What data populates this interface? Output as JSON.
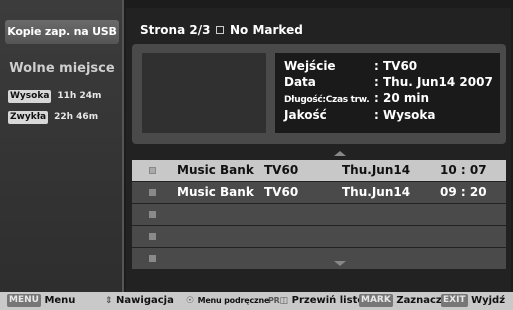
{
  "sidebar": {
    "title": "Kopie zap. na USB",
    "free_label": "Wolne miejsce",
    "qualities": [
      {
        "label": "Wysoka",
        "time": "11h 24m"
      },
      {
        "label": "Zwykła",
        "time": "22h 46m"
      }
    ]
  },
  "header": {
    "page": "Strona 2/3",
    "marked_icon": "checkbox-icon",
    "marked_text": "No Marked"
  },
  "details": {
    "channel_key": "Wejście",
    "channel_val": ": TV60",
    "date_key": "Data",
    "date_val": ": Thu. Jun14 2007",
    "duration_key": "Długość:Czas trw.",
    "duration_val": ": 20 min",
    "quality_key": "Jakość",
    "quality_val": ": Wysoka"
  },
  "recordings": [
    {
      "title": "Music Bank",
      "channel": "TV60",
      "date": "Thu.Jun14",
      "time": "10 : 07",
      "selected": true
    },
    {
      "title": "Music Bank",
      "channel": "TV60",
      "date": "Thu.Jun14",
      "time": "09 : 20",
      "selected": false
    },
    {
      "title": "",
      "channel": "",
      "date": "",
      "time": "",
      "selected": false
    },
    {
      "title": "",
      "channel": "",
      "date": "",
      "time": "",
      "selected": false
    },
    {
      "title": "",
      "channel": "",
      "date": "",
      "time": "",
      "selected": false
    }
  ],
  "footer": {
    "menu_key": "MENU",
    "menu_label": "Menu",
    "nav_icon": "up-down-arrows-icon",
    "nav_label": "Nawigacja",
    "ok_icon": "ok-circle-icon",
    "submenu_label": "Menu podręczne",
    "pr_key": "PR",
    "scroll_label": "Przewiń listę",
    "mark_key": "MARK",
    "mark_label": "Zaznacz",
    "exit_key": "EXIT",
    "exit_label": "Wyjdź"
  },
  "colors": {
    "background": "#1c1c1c",
    "panel": "#4a4a4a",
    "selected_row": "#c8c8c8",
    "footer": "#c9c9c9"
  }
}
